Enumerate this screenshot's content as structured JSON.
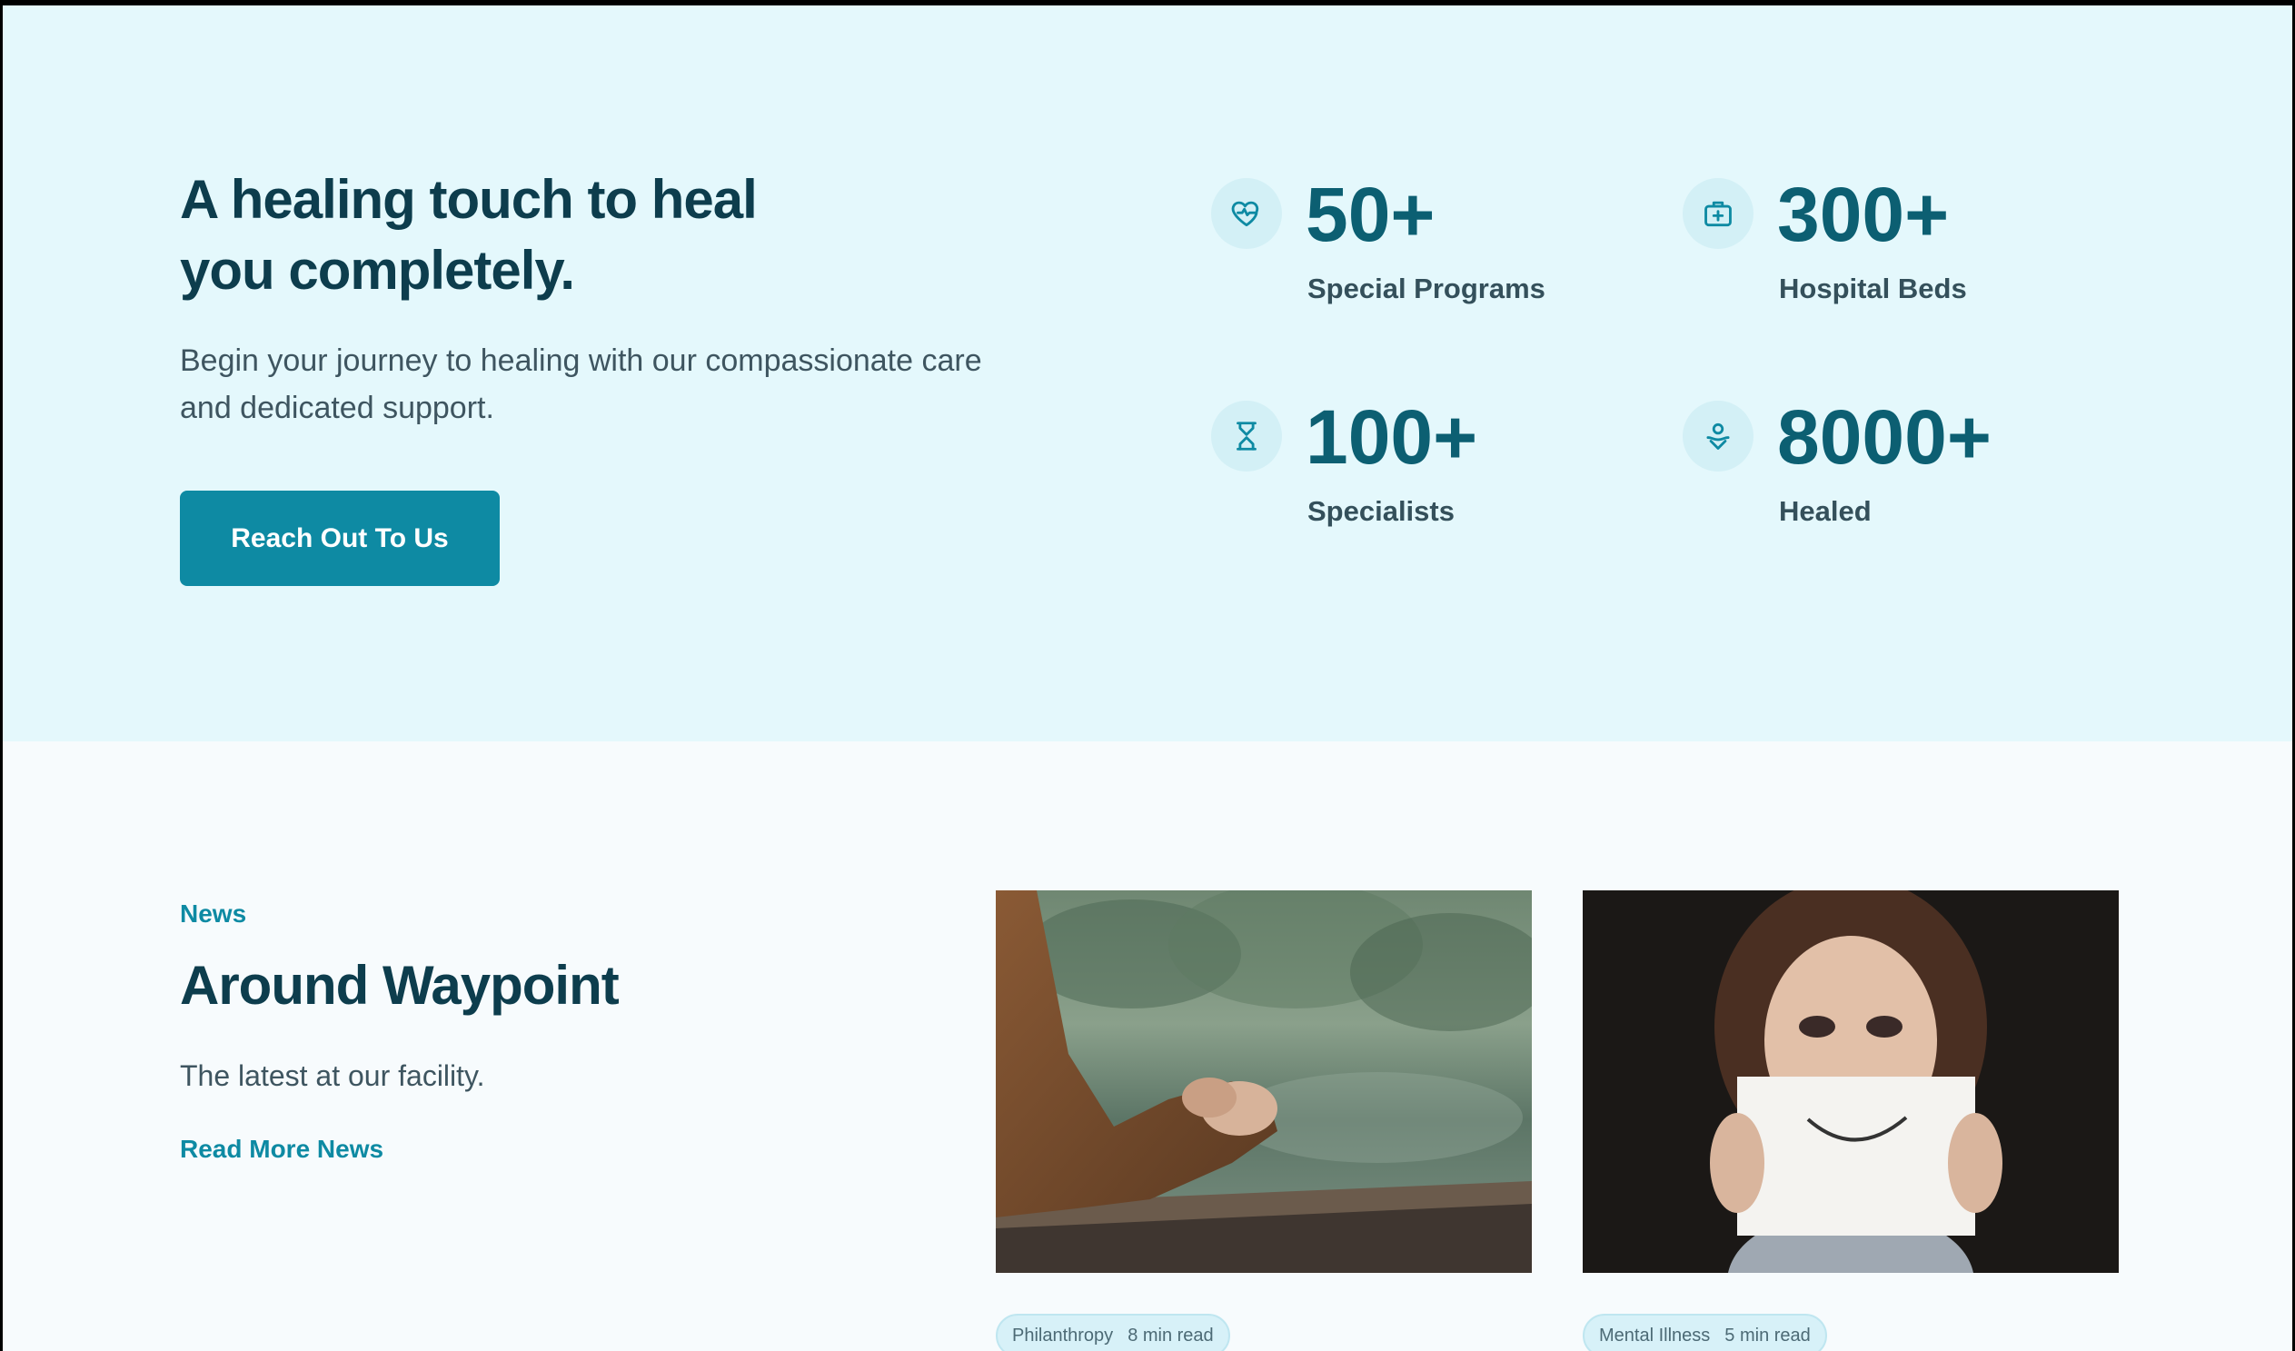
{
  "hero": {
    "title_line1": "A healing touch to heal",
    "title_line2": "you completely.",
    "subtitle_line1": "Begin your journey to healing with our compassionate care",
    "subtitle_line2": "and dedicated support.",
    "cta_label": "Reach Out To Us"
  },
  "stats": [
    {
      "icon": "heart-pulse-icon",
      "value": "50+",
      "label": "Special Programs"
    },
    {
      "icon": "medical-kit-icon",
      "value": "300+",
      "label": "Hospital Beds"
    },
    {
      "icon": "hourglass-icon",
      "value": "100+",
      "label": "Specialists"
    },
    {
      "icon": "heart-hand-icon",
      "value": "8000+",
      "label": "Healed"
    }
  ],
  "news": {
    "eyebrow": "News",
    "title": "Around Waypoint",
    "subtitle": "The latest at our facility.",
    "link_label": "Read More News",
    "cards": [
      {
        "image": "clasped-hands-lake-photo",
        "tag": "Philanthropy",
        "read_time": "8 min read"
      },
      {
        "image": "woman-holding-smile-paper-photo",
        "tag": "Mental Illness",
        "read_time": "5 min read"
      }
    ]
  },
  "colors": {
    "accent": "#0e8aa3",
    "heading": "#0d3d4d",
    "stat_value": "#0c5f72",
    "hero_bg": "#e4f8fc"
  }
}
